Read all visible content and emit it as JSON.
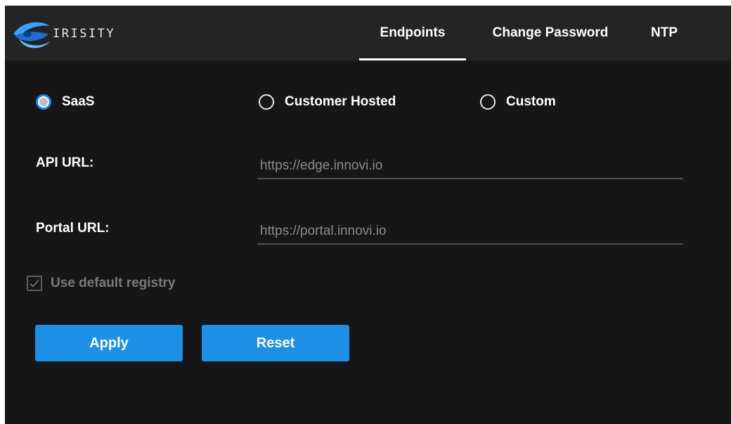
{
  "header": {
    "brand": "IRISITY",
    "logo_icon": "irisity-logo-icon",
    "tabs": [
      {
        "label": "Endpoints",
        "active": true
      },
      {
        "label": "Change Password",
        "active": false
      },
      {
        "label": "NTP",
        "active": false
      }
    ]
  },
  "hosting": {
    "options": [
      {
        "label": "SaaS",
        "checked": true
      },
      {
        "label": "Customer Hosted",
        "checked": false
      },
      {
        "label": "Custom",
        "checked": false
      }
    ]
  },
  "fields": {
    "api_url": {
      "label": "API URL:",
      "placeholder": "https://edge.innovi.io"
    },
    "portal_url": {
      "label": "Portal URL:",
      "placeholder": "https://portal.innovi.io"
    }
  },
  "registry": {
    "label": "Use default registry",
    "checked": true,
    "disabled": true
  },
  "actions": {
    "apply_label": "Apply",
    "reset_label": "Reset"
  },
  "colors": {
    "accent": "#1e8fe6",
    "background": "#161616",
    "topbar": "#242424"
  }
}
